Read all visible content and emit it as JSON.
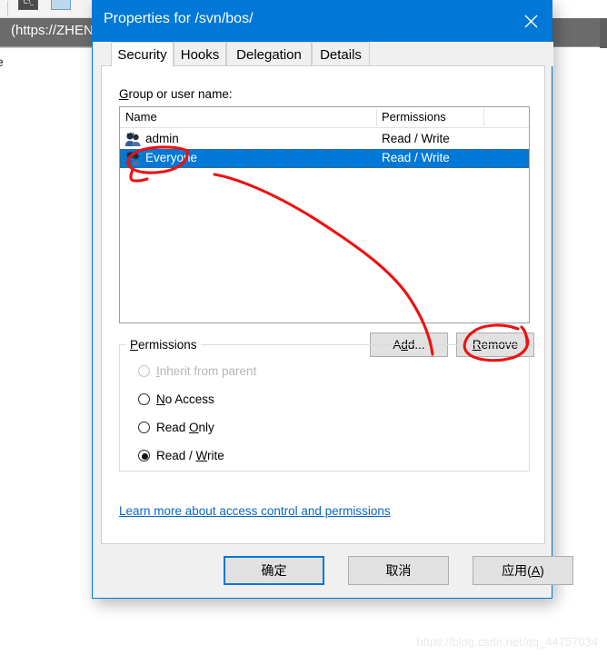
{
  "background": {
    "address_text": "(https://ZHEN",
    "page_text": "e",
    "toolbar_icons": [
      "console-icon",
      "image-icon"
    ]
  },
  "dialog": {
    "title": "Properties for /svn/bos/",
    "close_icon": "close-icon",
    "tabs": [
      {
        "label": "Security",
        "active": true
      },
      {
        "label": "Hooks",
        "active": false
      },
      {
        "label": "Delegation",
        "active": false
      },
      {
        "label": "Details",
        "active": false
      }
    ],
    "security": {
      "group_label_accel": "G",
      "group_label_rest": "roup or user name:",
      "list": {
        "columns": [
          "Name",
          "Permissions"
        ],
        "rows": [
          {
            "name": "admin",
            "permissions": "Read / Write",
            "selected": false,
            "icon": "users-group-icon"
          },
          {
            "name": "Everyone",
            "permissions": "Read / Write",
            "selected": true,
            "icon": "users-group-icon"
          }
        ]
      },
      "add_button": {
        "pre": "A",
        "accel": "d",
        "post": "d..."
      },
      "remove_button": {
        "accel": "R",
        "post": "emove"
      },
      "permissions_group": {
        "title": "Permissions",
        "title_accel": "P",
        "title_rest": "ermissions",
        "options": [
          {
            "pre": "",
            "accel": "I",
            "post": "nherit from parent",
            "checked": false,
            "disabled": true
          },
          {
            "pre": "",
            "accel": "N",
            "post": "o Access",
            "checked": false,
            "disabled": false
          },
          {
            "pre": "Read ",
            "accel": "O",
            "post": "nly",
            "checked": false,
            "disabled": false
          },
          {
            "pre": "Read / ",
            "accel": "W",
            "post": "rite",
            "checked": true,
            "disabled": false
          }
        ]
      },
      "help_link": "Learn more about access control and permissions"
    },
    "footer": {
      "ok": {
        "label": "确定",
        "default": true
      },
      "cancel": {
        "label": "取消",
        "default": false
      },
      "apply": {
        "pre": "应用(",
        "accel": "A",
        "post": ")",
        "default": false
      }
    }
  },
  "annotation": {
    "color": "#ee1111",
    "marks": [
      "ellipse-around-everyone-row",
      "curved-arrow",
      "ellipse-around-remove-button"
    ]
  },
  "watermark": "https://blog.csdn.net/qq_44757034",
  "colors": {
    "accent": "#0078d7",
    "selection": "#0078d7",
    "dialog_bg": "#f0f0f0",
    "annotation_red": "#ee1111",
    "link": "#0a66c2"
  }
}
